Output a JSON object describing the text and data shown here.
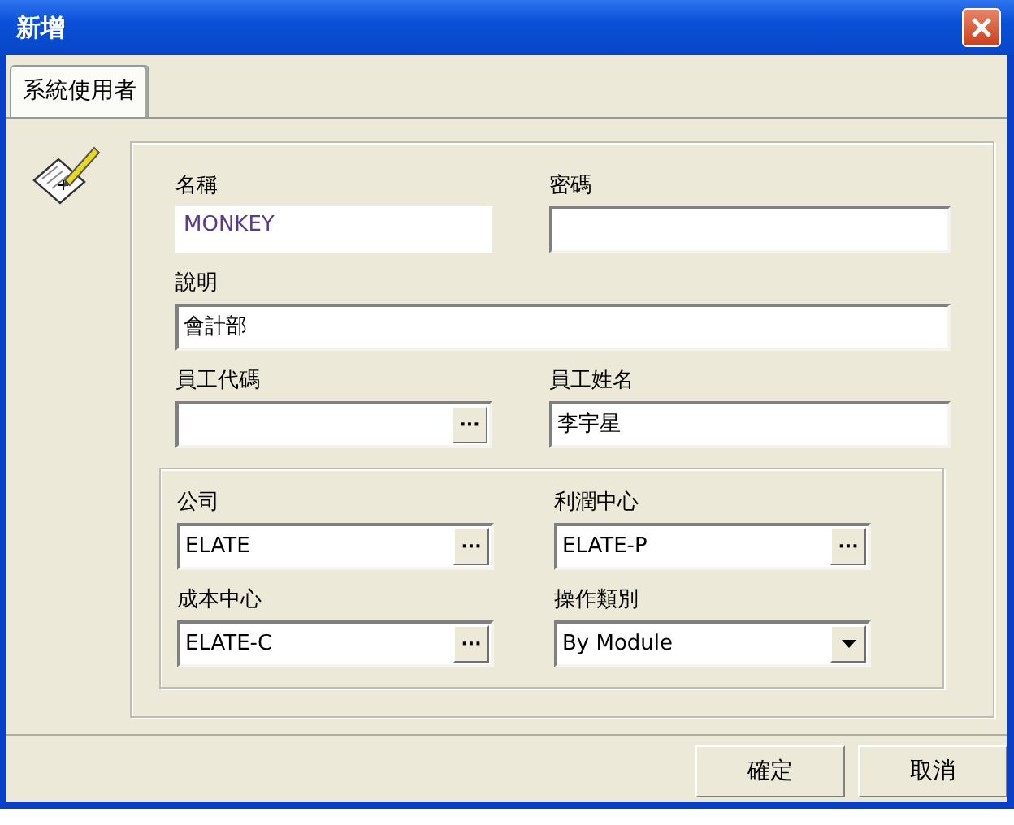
{
  "window": {
    "title": "新增"
  },
  "tabs": [
    {
      "label": "系統使用者",
      "selected": true
    }
  ],
  "fields": [
    {
      "label": "名稱",
      "value": "MONKEY",
      "kind": "readonly",
      "wide": false
    },
    {
      "label": "密碼",
      "kind": "text",
      "wide": false
    },
    {
      "label": "說明",
      "value": "會計部",
      "kind": "text",
      "wide": true
    },
    {
      "label": "員工代碼",
      "kind": "lookup",
      "button_text": "···",
      "wide": false
    },
    {
      "label": "員工姓名",
      "value": "李宇星",
      "kind": "text",
      "wide": false
    }
  ],
  "group": [
    {
      "label": "公司",
      "value": "ELATE",
      "kind": "lookup",
      "button_text": "···"
    },
    {
      "label": "利潤中心",
      "value": "ELATE-P",
      "kind": "lookup",
      "button_text": "···"
    },
    {
      "label": "成本中心",
      "value": "ELATE-C",
      "kind": "lookup",
      "button_text": "···"
    },
    {
      "label": "操作類別",
      "value": "By Module",
      "kind": "select"
    }
  ],
  "buttons": [
    "確定",
    "取消"
  ]
}
